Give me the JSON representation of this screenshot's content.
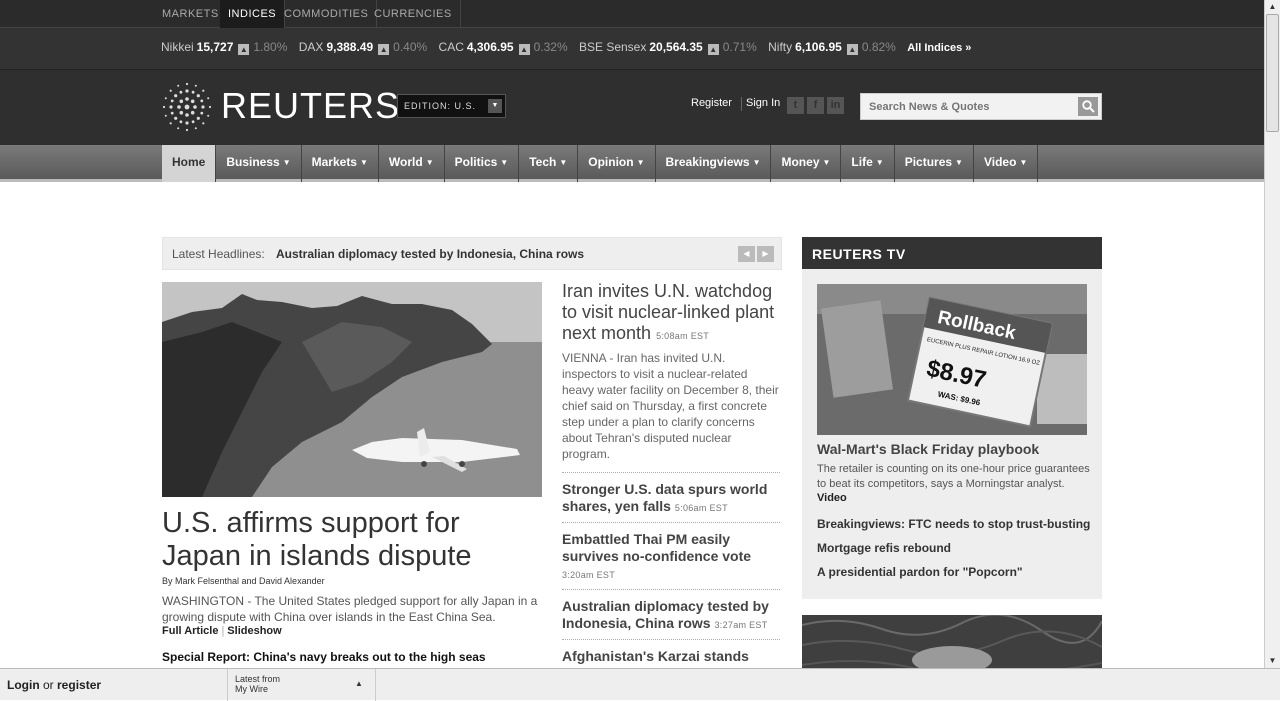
{
  "market_tabs": [
    {
      "label": "MARKETS"
    },
    {
      "label": "INDICES"
    },
    {
      "label": "COMMODITIES"
    },
    {
      "label": "CURRENCIES"
    }
  ],
  "ticker": {
    "items": [
      {
        "name": "Nikkei",
        "value": "15,727",
        "pct": "1.80%"
      },
      {
        "name": "DAX",
        "value": "9,388.49",
        "pct": "0.40%"
      },
      {
        "name": "CAC",
        "value": "4,306.95",
        "pct": "0.32%"
      },
      {
        "name": "BSE Sensex",
        "value": "20,564.35",
        "pct": "0.71%"
      },
      {
        "name": "Nifty",
        "value": "6,106.95",
        "pct": "0.82%"
      }
    ],
    "all_indices": "All Indices »"
  },
  "header": {
    "logo_text": "REUTERS",
    "edition": "EDITION: U.S.",
    "register": "Register",
    "sign_in": "Sign In",
    "search_placeholder": "Search News & Quotes"
  },
  "nav": [
    {
      "label": "Home"
    },
    {
      "label": "Business"
    },
    {
      "label": "Markets"
    },
    {
      "label": "World"
    },
    {
      "label": "Politics"
    },
    {
      "label": "Tech"
    },
    {
      "label": "Opinion"
    },
    {
      "label": "Breakingviews"
    },
    {
      "label": "Money"
    },
    {
      "label": "Life"
    },
    {
      "label": "Pictures"
    },
    {
      "label": "Video"
    }
  ],
  "latest": {
    "label": "Latest Headlines:",
    "headline": "Australian diplomacy tested by Indonesia, China rows"
  },
  "main_story": {
    "title": "U.S. affirms support for Japan in islands dispute",
    "byline": "By Mark Felsenthal and David Alexander",
    "summary": "WASHINGTON - The United States pledged support for ally Japan in a growing dispute with China over islands in the East China Sea.",
    "full_article": "Full Article",
    "slideshow": "Slideshow",
    "special_report": "Special Report: China's navy breaks out to the high seas"
  },
  "middle": {
    "lead_title": "Iran invites U.N. watchdog to visit nuclear-linked plant next month",
    "lead_time": "5:08am EST",
    "lead_summary": "VIENNA - Iran has invited U.N. inspectors to visit a nuclear-related heavy water facility on December 8, their chief said on Thursday, a first concrete step under a plan to clarify concerns about Tehran's disputed nuclear program.",
    "stories": [
      {
        "title": "Stronger U.S. data spurs world shares, yen falls",
        "time": "5:06am EST"
      },
      {
        "title": "Embattled Thai PM easily survives no-confidence vote",
        "time": "3:20am EST"
      },
      {
        "title": "Australian diplomacy tested by Indonesia, China rows",
        "time": "3:27am EST"
      },
      {
        "title": "Afghanistan's Karzai stands",
        "time": ""
      }
    ]
  },
  "reuters_tv": {
    "heading": "REUTERS TV",
    "title": "Wal-Mart's Black Friday playbook",
    "summary": "The retailer is counting on its one-hour price guarantees to beat its competitors, says a Morningstar analyst.",
    "video_label": "Video",
    "links": [
      "Breakingviews: FTC needs to stop trust-busting",
      "Mortgage refis rebound",
      "A presidential pardon for \"Popcorn\""
    ],
    "photo_sign": {
      "brand": "Rollback",
      "product": "EUCERIN PLUS REPAIR LOTION 16.9 OZ",
      "price": "$8.97",
      "was": "WAS: $9.96"
    }
  },
  "bottom_bar": {
    "login": "Login",
    "or": "or",
    "register": "register",
    "wire_line1": "Latest from",
    "wire_line2": "My Wire"
  }
}
